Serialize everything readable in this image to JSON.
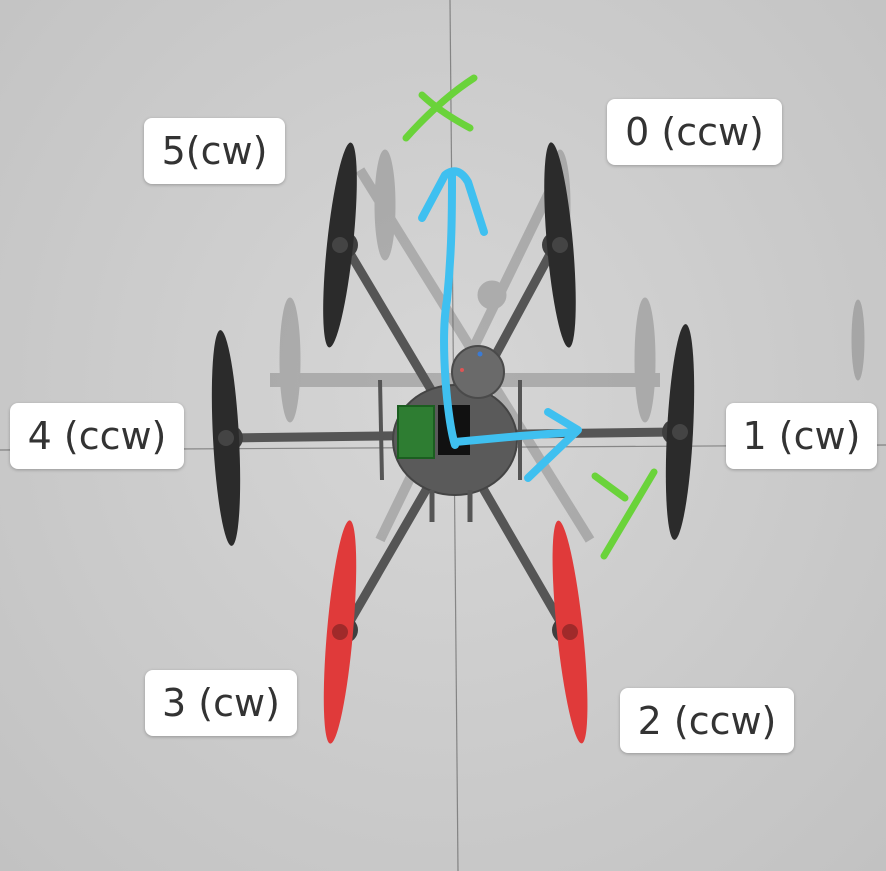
{
  "motors": [
    {
      "index": "0",
      "label": "0 (ccw)"
    },
    {
      "index": "1",
      "label": "1 (cw)"
    },
    {
      "index": "2",
      "label": "2 (ccw)"
    },
    {
      "index": "3",
      "label": "3 (cw)"
    },
    {
      "index": "4",
      "label": "4 (ccw)"
    },
    {
      "index": "5",
      "label": "5(cw)"
    }
  ],
  "axes": {
    "x_letter": "X",
    "y_letter": "Y"
  },
  "colors": {
    "background": "#cdcdcd",
    "front_propellers": "#2b2b2b",
    "rear_propellers": "#e03a3a",
    "frame": "#555555",
    "axis_arrows": "#3fc0f0",
    "axis_letters": "#6ad33a",
    "label_bg": "#ffffff",
    "label_text": "#333333"
  }
}
